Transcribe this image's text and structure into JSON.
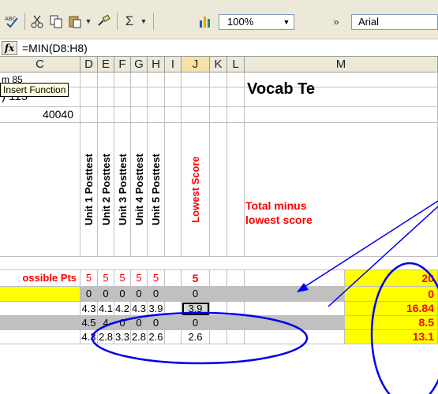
{
  "toolbar": {
    "zoom": "100%",
    "font": "Arial",
    "overflow": "»"
  },
  "formula_bar": {
    "fx": "fx",
    "formula": "=MIN(D8:H8)"
  },
  "tooltip": "Insert Function",
  "columns": [
    "C",
    "D",
    "E",
    "F",
    "G",
    "H",
    "I",
    "J",
    "K",
    "L",
    "M"
  ],
  "selected_column": "J",
  "cells": {
    "c_row1": "m 85",
    "c_row2": ") 115",
    "c_row3": "40040",
    "unit1": "Unit 1 Posttest",
    "unit2": "Unit 2 Posttest",
    "unit3": "Unit 3 Posttest",
    "unit4": "Unit 4 Posttest",
    "unit5": "Unit 5 Posttest",
    "lowest": "Lowest Score",
    "vocab": "Vocab Te",
    "total_minus": "Total minus lowest score",
    "possible_pts": "ossible Pts"
  },
  "data_rows": [
    {
      "d": "5",
      "e": "5",
      "f": "5",
      "g": "5",
      "h": "5",
      "j": "5",
      "m": "20"
    },
    {
      "d": "0",
      "e": "0",
      "f": "0",
      "g": "0",
      "h": "0",
      "j": "0",
      "m": "0"
    },
    {
      "d": "4.3",
      "e": "4.1",
      "f": "4.2",
      "g": "4.3",
      "h": "3.9",
      "j": "3.9",
      "m": "16.84"
    },
    {
      "d": "4.5",
      "e": "4",
      "f": "0",
      "g": "0",
      "h": "0",
      "j": "0",
      "m": "8.5"
    },
    {
      "d": "4.3",
      "e": "2.8",
      "f": "3.3",
      "g": "2.8",
      "h": "2.6",
      "j": "2.6",
      "m": "13.1"
    }
  ],
  "colors": {
    "highlight_yellow": "#ffff00",
    "gray_row": "#c0c0c0",
    "annotation_blue": "#0000ee",
    "red_text": "#ff0000"
  }
}
